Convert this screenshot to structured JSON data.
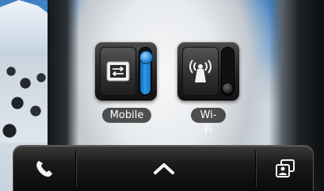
{
  "widgets": {
    "mobile": {
      "label": "Mobile",
      "icon": "mobile-data-icon",
      "state": "on",
      "accent": "#2e9be6"
    },
    "wifi": {
      "label": "Wi-Fi",
      "icon": "wifi-antenna-icon",
      "state": "off"
    }
  },
  "dock": {
    "left_icon": "phone-icon",
    "center_icon": "chevron-up-icon",
    "right_icon": "switch-view-icon"
  }
}
